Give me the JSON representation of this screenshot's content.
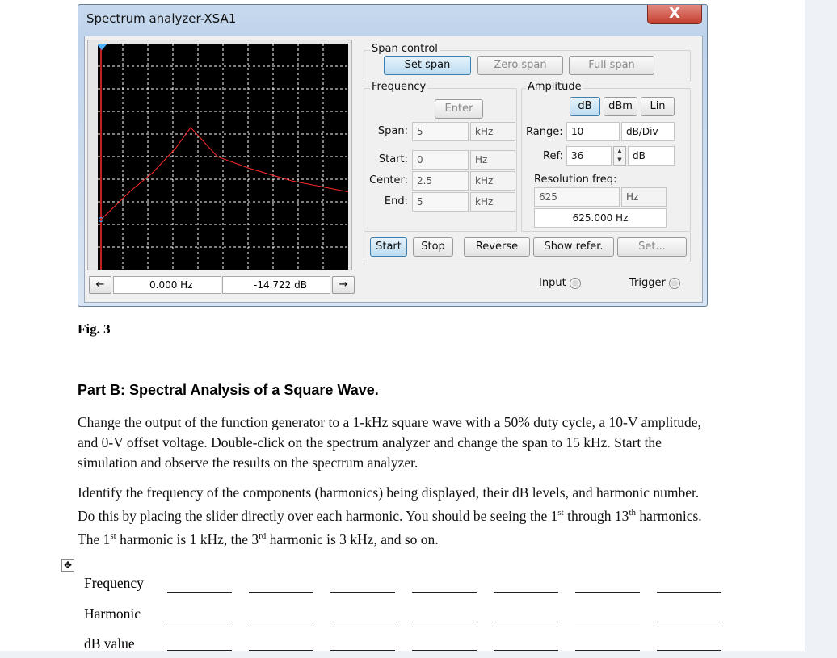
{
  "window": {
    "title": "Spectrum analyzer-XSA1",
    "close_label": "X"
  },
  "readouts": {
    "left_arrow": "←",
    "frequency": "0.000 Hz",
    "level": "-14.722 dB",
    "right_arrow": "→"
  },
  "span_control": {
    "title": "Span control",
    "set_span": "Set span",
    "zero_span": "Zero span",
    "full_span": "Full span"
  },
  "frequency": {
    "title": "Frequency",
    "enter": "Enter",
    "span_label": "Span:",
    "span_value": "5",
    "span_unit": "kHz",
    "start_label": "Start:",
    "start_value": "0",
    "start_unit": "Hz",
    "center_label": "Center:",
    "center_value": "2.5",
    "center_unit": "kHz",
    "end_label": "End:",
    "end_value": "5",
    "end_unit": "kHz"
  },
  "amplitude": {
    "title": "Amplitude",
    "db": "dB",
    "dbm": "dBm",
    "lin": "Lin",
    "range_label": "Range:",
    "range_value": "10",
    "range_unit": "dB/Div",
    "ref_label": "Ref:",
    "ref_value": "36",
    "ref_unit": "dB"
  },
  "resolution": {
    "title": "Resolution freq:",
    "value": "625",
    "unit": "Hz",
    "display": "625.000 Hz"
  },
  "controls": {
    "start": "Start",
    "stop": "Stop",
    "reverse": "Reverse",
    "show_refer": "Show refer.",
    "set": "Set..."
  },
  "io": {
    "input": "Input",
    "trigger": "Trigger"
  },
  "display": {
    "colors": {
      "trace": "#ff2a2a",
      "cursor": "#ff2a2a",
      "grid": "#ffffff",
      "background": "#000000"
    }
  },
  "document": {
    "fig_caption": "Fig. 3",
    "part_b_heading": "Part B: Spectral Analysis of a Square Wave.",
    "para1": "Change the output of the function generator to a 1-kHz square wave with a 50% duty cycle, a 10-V amplitude, and 0-V offset voltage. Double-click on the spectrum analyzer and change the span to 15 kHz. Start the simulation and observe the results on the spectrum analyzer.",
    "para2_a": "Identify the frequency of the components (harmonics) being displayed, their dB levels, and harmonic number. Do this by placing the slider directly over each harmonic. You should be seeing the 1",
    "sup_st1": "st",
    "para2_b": " through 13",
    "sup_th": "th",
    "para2_c": " harmonics. The 1",
    "sup_st2": "st",
    "para2_d": " harmonic is 1 kHz, the 3",
    "sup_rd": "rd",
    "para2_e": " harmonic is 3 kHz, and so on.",
    "row_frequency": "Frequency",
    "row_harmonic": "Harmonic",
    "row_db": "dB value"
  }
}
